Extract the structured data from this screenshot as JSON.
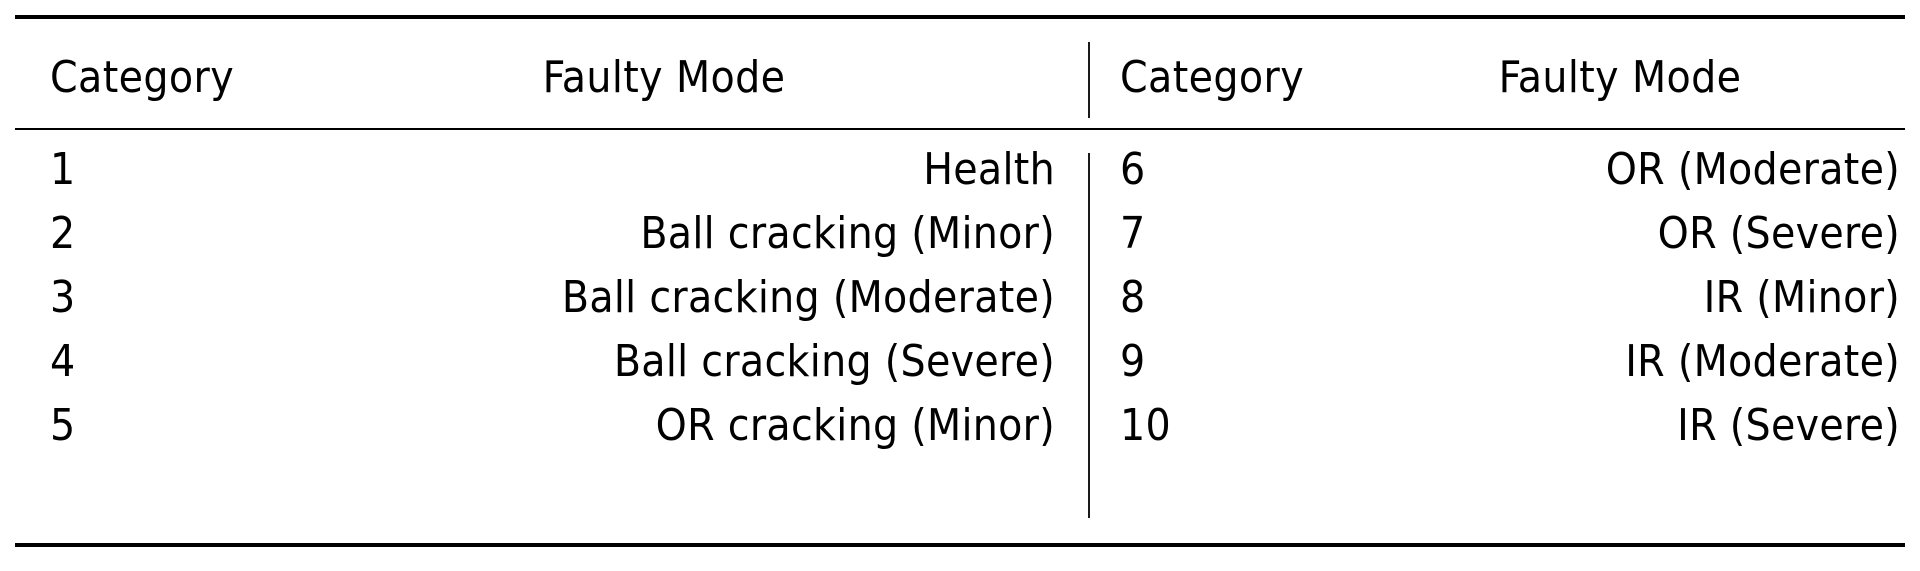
{
  "table": {
    "headers": {
      "category": "Category",
      "faulty_mode": "Faulty Mode"
    },
    "left_block": [
      {
        "category": "1",
        "faulty_mode": "Health"
      },
      {
        "category": "2",
        "faulty_mode": "Ball cracking (Minor)"
      },
      {
        "category": "3",
        "faulty_mode": "Ball cracking (Moderate)"
      },
      {
        "category": "4",
        "faulty_mode": "Ball cracking (Severe)"
      },
      {
        "category": "5",
        "faulty_mode": "OR cracking (Minor)"
      }
    ],
    "right_block": [
      {
        "category": "6",
        "faulty_mode": "OR (Moderate)"
      },
      {
        "category": "7",
        "faulty_mode": "OR (Severe)"
      },
      {
        "category": "8",
        "faulty_mode": "IR (Minor)"
      },
      {
        "category": "9",
        "faulty_mode": "IR (Moderate)"
      },
      {
        "category": "10",
        "faulty_mode": "IR (Severe)"
      }
    ],
    "style": {
      "text_color": "#000000",
      "background": "#ffffff",
      "rule_color": "#000000"
    }
  }
}
